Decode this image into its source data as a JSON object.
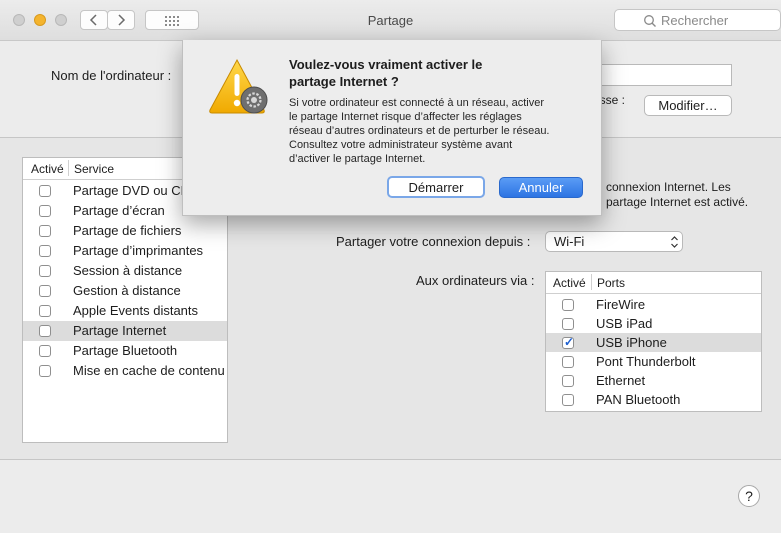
{
  "window": {
    "title": "Partage",
    "search_placeholder": "Rechercher"
  },
  "computer_name": {
    "label": "Nom de l'ordinateur :",
    "value": "",
    "address_label_fragment": "esse :",
    "modify_button": "Modifier…"
  },
  "services_table": {
    "col_active": "Activé",
    "col_service": "Service",
    "rows": [
      {
        "label": "Partage DVD ou CD",
        "checked": false,
        "selected": false
      },
      {
        "label": "Partage d’écran",
        "checked": false,
        "selected": false
      },
      {
        "label": "Partage de fichiers",
        "checked": false,
        "selected": false
      },
      {
        "label": "Partage d’imprimantes",
        "checked": false,
        "selected": false
      },
      {
        "label": "Session à distance",
        "checked": false,
        "selected": false
      },
      {
        "label": "Gestion à distance",
        "checked": false,
        "selected": false
      },
      {
        "label": "Apple Events distants",
        "checked": false,
        "selected": false
      },
      {
        "label": "Partage Internet",
        "checked": false,
        "selected": true
      },
      {
        "label": "Partage Bluetooth",
        "checked": false,
        "selected": false
      },
      {
        "label": "Mise en cache de contenu",
        "checked": false,
        "selected": false
      }
    ]
  },
  "description": {
    "line1": "connexion Internet. Les",
    "line2": "partage Internet est activé."
  },
  "share_from": {
    "label": "Partager votre connexion depuis :",
    "value": "Wi-Fi"
  },
  "computers_via": {
    "label": "Aux ordinateurs via :",
    "col_active": "Activé",
    "col_ports": "Ports",
    "rows": [
      {
        "label": "FireWire",
        "checked": false,
        "selected": false
      },
      {
        "label": "USB iPad",
        "checked": false,
        "selected": false
      },
      {
        "label": "USB iPhone",
        "checked": true,
        "selected": true
      },
      {
        "label": "Pont Thunderbolt",
        "checked": false,
        "selected": false
      },
      {
        "label": "Ethernet",
        "checked": false,
        "selected": false
      },
      {
        "label": "PAN Bluetooth",
        "checked": false,
        "selected": false
      }
    ]
  },
  "dialog": {
    "title_line1": "Voulez-vous vraiment activer le",
    "title_line2": "partage Internet ?",
    "body_lines": [
      "Si votre ordinateur est connecté à un réseau, activer",
      "le partage Internet risque d’affecter les réglages",
      "réseau d’autres ordinateurs et de perturber le réseau.",
      "Consultez votre administrateur système avant",
      "d’activer le partage Internet."
    ],
    "start_button": "Démarrer",
    "cancel_button": "Annuler"
  },
  "help_glyph": "?",
  "colors": {
    "accent": "#2f7be0",
    "close": "#ff5f57",
    "minimize": "#febc2e",
    "zoom": "#c9c9c9"
  }
}
